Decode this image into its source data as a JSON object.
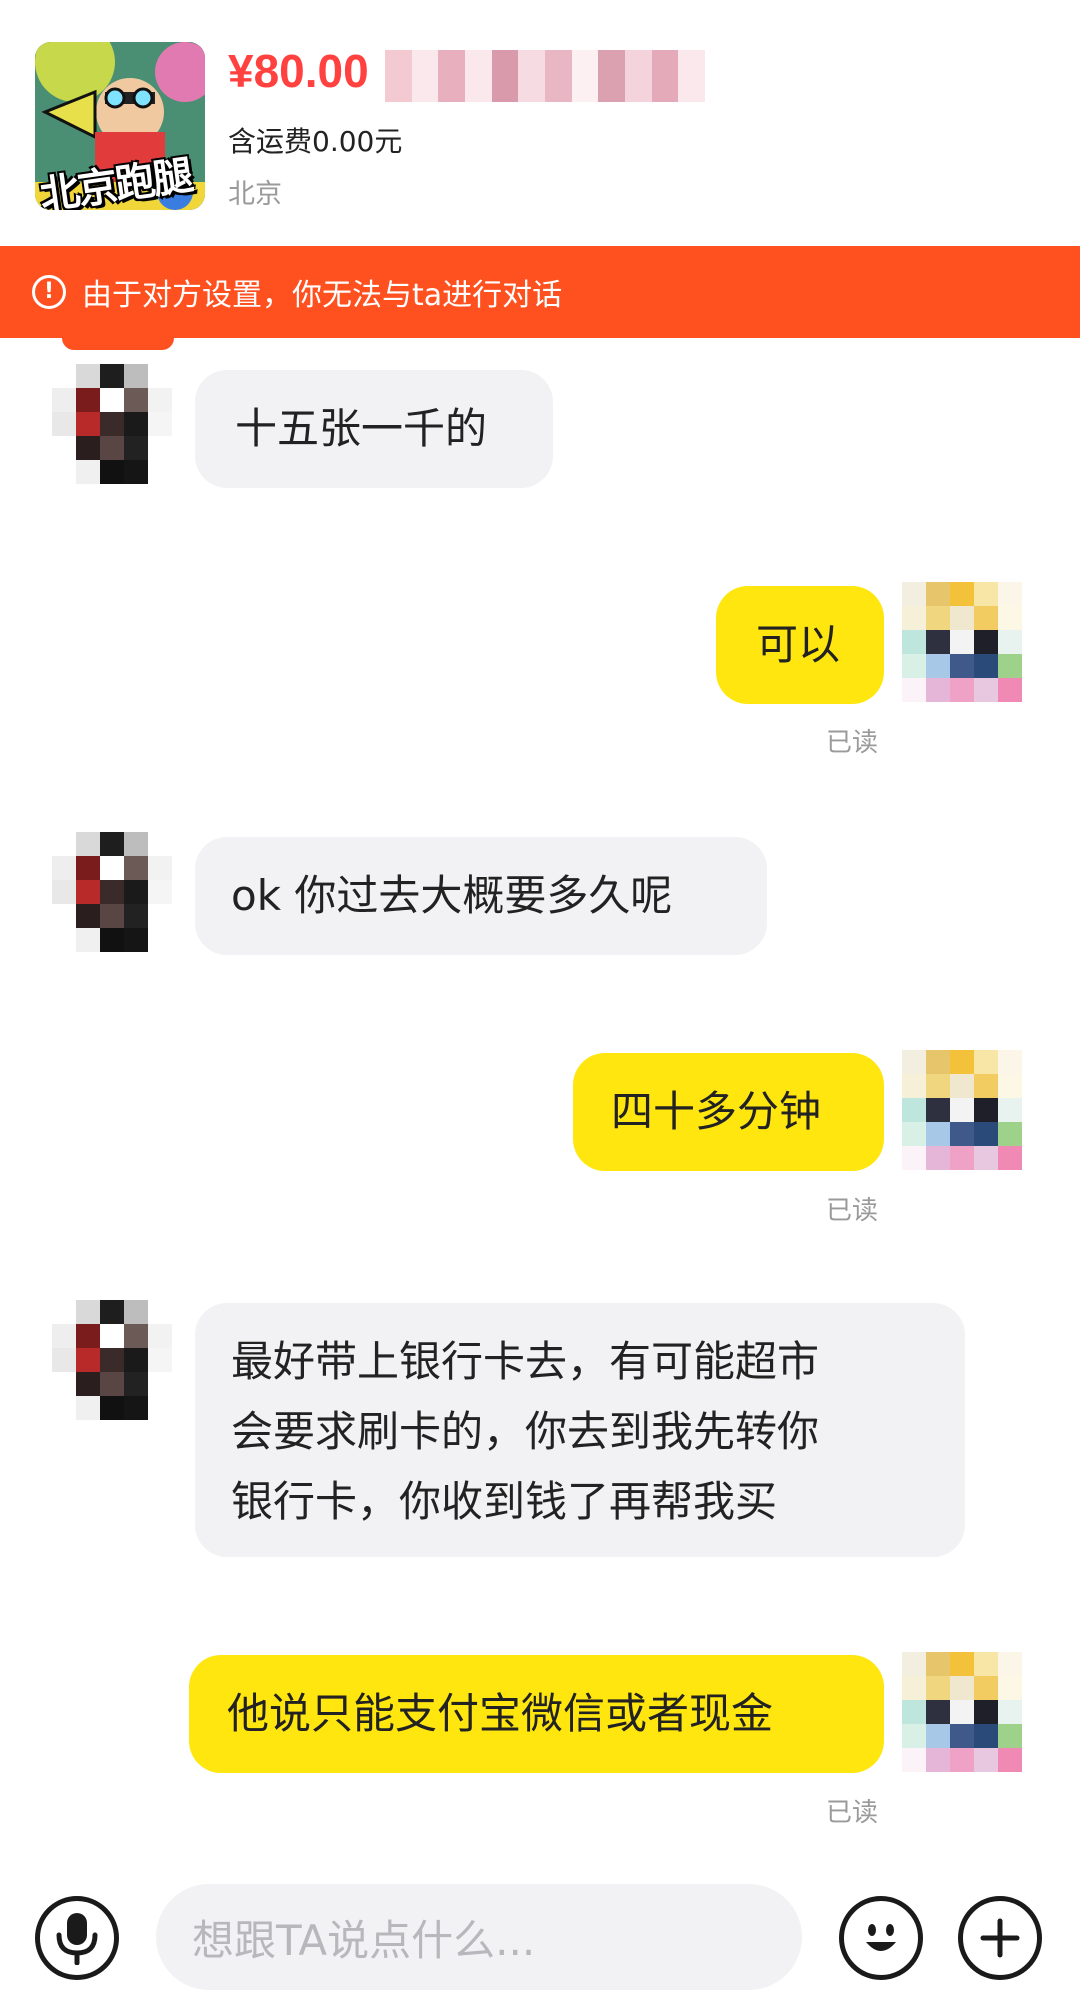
{
  "product": {
    "price": "¥80.00",
    "shipping": "含运费0.00元",
    "location": "北京",
    "thumbnail_text": "北京跑腿"
  },
  "banner": {
    "text": "由于对方设置，你无法与ta进行对话",
    "icon": "exclamation-circle-icon",
    "color": "#ff5020"
  },
  "messages": [
    {
      "from": "other",
      "text": "十五张一千的"
    },
    {
      "from": "me",
      "text": "可以",
      "status": "已读"
    },
    {
      "from": "other",
      "text": "ok 你过去大概要多久呢"
    },
    {
      "from": "me",
      "text": "四十多分钟",
      "status": "已读"
    },
    {
      "from": "other",
      "lines": [
        "最好带上银行卡去，有可能超市",
        "会要求刷卡的，你去到我先转你",
        "银行卡，你收到钱了再帮我买"
      ]
    },
    {
      "from": "me",
      "text": "他说只能支付宝微信或者现金",
      "status": "已读"
    }
  ],
  "input": {
    "placeholder": "想跟TA说点什么...",
    "voice_icon": "microphone-icon",
    "emoji_icon": "emoji-icon",
    "plus_icon": "plus-icon"
  },
  "colors": {
    "price": "#ff4240",
    "my_bubble": "#ffe60f",
    "their_bubble": "#f2f2f4"
  }
}
